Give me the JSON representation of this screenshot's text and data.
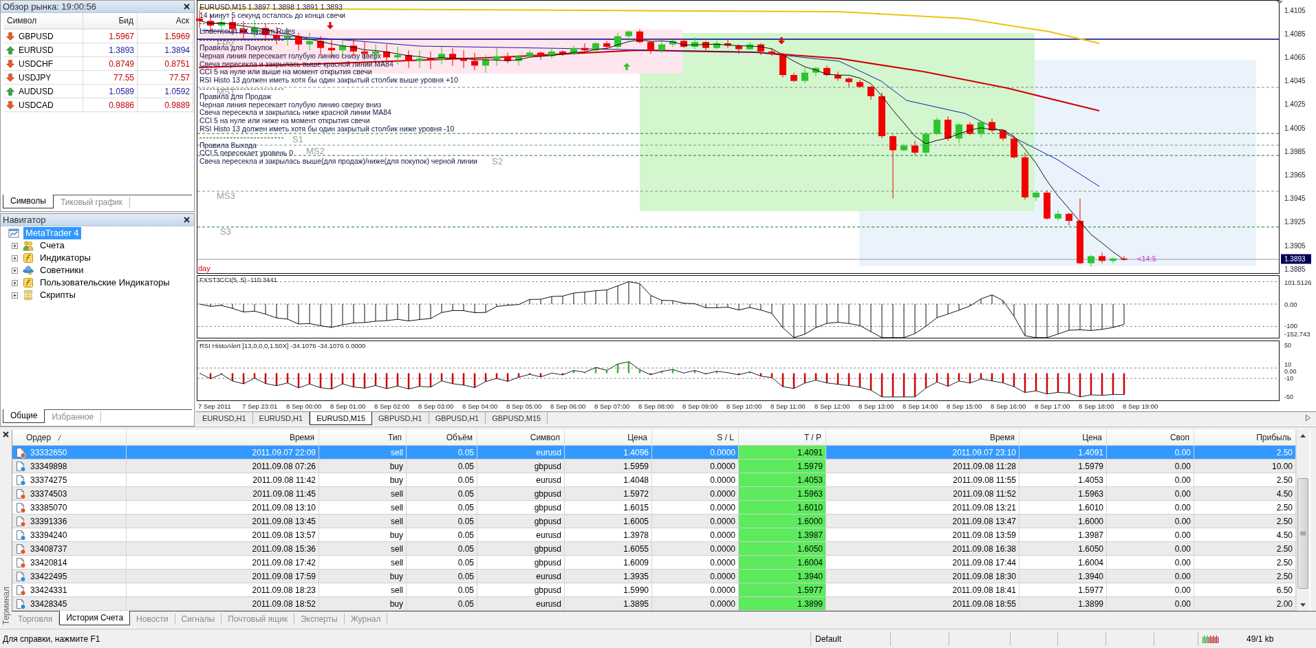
{
  "market_watch": {
    "title": "Обзор рынка: 19:00:56",
    "columns": [
      "Символ",
      "Бид",
      "Аск"
    ],
    "rows": [
      {
        "symbol": "GBPUSD",
        "bid": "1.5967",
        "ask": "1.5969",
        "rising": false
      },
      {
        "symbol": "EURUSD",
        "bid": "1.3893",
        "ask": "1.3894",
        "rising": true
      },
      {
        "symbol": "USDCHF",
        "bid": "0.8749",
        "ask": "0.8751",
        "rising": false
      },
      {
        "symbol": "USDJPY",
        "bid": "77.55",
        "ask": "77.57",
        "rising": false
      },
      {
        "symbol": "AUDUSD",
        "bid": "1.0589",
        "ask": "1.0592",
        "rising": true
      },
      {
        "symbol": "USDCAD",
        "bid": "0.9886",
        "ask": "0.9889",
        "rising": false
      }
    ],
    "tabs": [
      {
        "label": "Символы",
        "selected": true
      },
      {
        "label": "Тиковый график",
        "selected": false
      }
    ]
  },
  "navigator": {
    "title": "Навигатор",
    "tree": [
      {
        "label": "MetaTrader 4",
        "kind": "terminal",
        "selected": true,
        "children": [
          {
            "label": "Счета",
            "kind": "accounts",
            "selected": false,
            "expanded": false
          },
          {
            "label": "Индикаторы",
            "kind": "indicators",
            "selected": false,
            "expanded": false
          },
          {
            "label": "Советники",
            "kind": "experts",
            "selected": false,
            "expanded": false
          },
          {
            "label": "Пользовательские Индикаторы",
            "kind": "custom_indicators",
            "selected": false,
            "expanded": false
          },
          {
            "label": "Скрипты",
            "kind": "scripts",
            "selected": false,
            "expanded": false
          }
        ]
      }
    ],
    "tabs": [
      {
        "label": "Общие",
        "selected": true
      },
      {
        "label": "Избранное",
        "selected": false
      }
    ]
  },
  "chart": {
    "title": "EURUSD,M15 1.3897 1.3898 1.3891 1.3893",
    "notes": [
      {
        "kind": "text",
        "text": "14 минут 5 секунд осталось до конца свечи"
      },
      {
        "kind": "separator"
      },
      {
        "kind": "text",
        "text": "Lindencourt FX System Rules"
      },
      {
        "kind": "separator"
      },
      {
        "kind": "text",
        "text": "Правила для Покупок"
      },
      {
        "kind": "text",
        "text": "Черная линия пересекает голубую линию снизу вверх"
      },
      {
        "kind": "text",
        "text": "Свеча пересекла и закрылась выше красной линии MA84"
      },
      {
        "kind": "text",
        "text": "CCI 5 на нуле или выше на момент открытия свечи"
      },
      {
        "kind": "text",
        "text": "RSI Histo 13 должен иметь хотя бы один закрытый столбик выше уровня +10"
      },
      {
        "kind": "separator"
      },
      {
        "kind": "text",
        "text": "Правила для Продаж"
      },
      {
        "kind": "text",
        "text": "Черная линия пересекает голубую линию сверху вниз"
      },
      {
        "kind": "text",
        "text": "Свеча пересекла и закрылась ниже красной линии MA84"
      },
      {
        "kind": "text",
        "text": "CCI 5 на нуле или ниже на момент открытия свечи"
      },
      {
        "kind": "text",
        "text": "RSI Histo 13 должен иметь хотя бы один закрытый столбик ниже уровня -10"
      },
      {
        "kind": "separator"
      },
      {
        "kind": "text",
        "text": "Правила Выхода"
      },
      {
        "kind": "text",
        "text": "CCI 5 пересекает уровень 0"
      },
      {
        "kind": "text",
        "text": "Свеча пересекла и закрылась выше(для продаж)/ниже(для покупок) черной линии"
      }
    ],
    "levels": [
      {
        "label": "FPV",
        "kind": "pivot"
      },
      {
        "label": "MS1",
        "kind": "mid"
      },
      {
        "label": "S1",
        "kind": "support"
      },
      {
        "label": "MS2",
        "kind": "mid"
      },
      {
        "label": "S2",
        "kind": "support"
      },
      {
        "label": "MS3",
        "kind": "mid"
      },
      {
        "label": "S3",
        "kind": "support"
      }
    ],
    "period_label": "day",
    "countdown": "<14:5",
    "price_axis": [
      "1.4105",
      "1.4085",
      "1.4065",
      "1.4045",
      "1.4025",
      "1.4005",
      "1.3985",
      "1.3965",
      "1.3945",
      "1.3925",
      "1.3905",
      "1.3885"
    ],
    "current_price": "1.3893",
    "cci": {
      "title": "FXST3CCI(5, 5) -110.3441",
      "axis": [
        "101.5126",
        "0.00",
        "-100",
        "-152.743"
      ]
    },
    "rsi": {
      "title": "RSI HistoAlert [13,0,0,0,1.50X] -34.1076 -34.1076 0.0000",
      "axis": [
        "50",
        "10",
        "0.00",
        "-10",
        "-50"
      ]
    },
    "time_axis": [
      "7 Sep 2011",
      "7 Sep 23:01",
      "8 Sep 00:00",
      "8 Sep 01:00",
      "8 Sep 02:00",
      "8 Sep 03:00",
      "8 Sep 04:00",
      "8 Sep 05:00",
      "8 Sep 06:00",
      "8 Sep 07:00",
      "8 Sep 08:00",
      "8 Sep 09:00",
      "8 Sep 10:00",
      "8 Sep 11:00",
      "8 Sep 12:00",
      "8 Sep 13:00",
      "8 Sep 14:00",
      "8 Sep 15:00",
      "8 Sep 16:00",
      "8 Sep 17:00",
      "8 Sep 18:00",
      "8 Sep 19:00"
    ]
  },
  "chart_tabs": [
    {
      "label": "EURUSD,H1",
      "selected": false
    },
    {
      "label": "EURUSD,H1",
      "selected": false
    },
    {
      "label": "EURUSD,M15",
      "selected": true
    },
    {
      "label": "GBPUSD,H1",
      "selected": false
    },
    {
      "label": "GBPUSD,H1",
      "selected": false
    },
    {
      "label": "GBPUSD,M15",
      "selected": false
    }
  ],
  "terminal": {
    "title": "Терминал",
    "columns": [
      {
        "label": "Ордер",
        "sorted": true,
        "highlighted": false
      },
      {
        "label": "Время",
        "sorted": false,
        "highlighted": false
      },
      {
        "label": "Тип",
        "sorted": false,
        "highlighted": false
      },
      {
        "label": "Объём",
        "sorted": false,
        "highlighted": false
      },
      {
        "label": "Символ",
        "sorted": false,
        "highlighted": false
      },
      {
        "label": "Цена",
        "sorted": false,
        "highlighted": false
      },
      {
        "label": "S / L",
        "sorted": false,
        "highlighted": false
      },
      {
        "label": "T / P",
        "sorted": false,
        "highlighted": true
      },
      {
        "label": "Время",
        "sorted": false,
        "highlighted": false
      },
      {
        "label": "Цена",
        "sorted": false,
        "highlighted": false
      },
      {
        "label": "Своп",
        "sorted": false,
        "highlighted": false
      },
      {
        "label": "Прибыль",
        "sorted": false,
        "highlighted": false
      }
    ],
    "rows": [
      {
        "kind": "sell",
        "selected": true,
        "cells": [
          "33332650",
          "2011.09.07 22:09",
          "sell",
          "0.05",
          "eurusd",
          "1.4096",
          "0.0000",
          "1.4091",
          "2011.09.07 23:10",
          "1.4091",
          "0.00",
          "2.50"
        ]
      },
      {
        "kind": "buy",
        "selected": false,
        "cells": [
          "33349898",
          "2011.09.08 07:26",
          "buy",
          "0.05",
          "gbpusd",
          "1.5959",
          "0.0000",
          "1.5979",
          "2011.09.08 11:28",
          "1.5979",
          "0.00",
          "10.00"
        ]
      },
      {
        "kind": "buy",
        "selected": false,
        "cells": [
          "33374275",
          "2011.09.08 11:42",
          "buy",
          "0.05",
          "eurusd",
          "1.4048",
          "0.0000",
          "1.4053",
          "2011.09.08 11:55",
          "1.4053",
          "0.00",
          "2.50"
        ]
      },
      {
        "kind": "sell",
        "selected": false,
        "cells": [
          "33374503",
          "2011.09.08 11:45",
          "sell",
          "0.05",
          "gbpusd",
          "1.5972",
          "0.0000",
          "1.5963",
          "2011.09.08 11:52",
          "1.5963",
          "0.00",
          "4.50"
        ]
      },
      {
        "kind": "sell",
        "selected": false,
        "cells": [
          "33385070",
          "2011.09.08 13:10",
          "sell",
          "0.05",
          "gbpusd",
          "1.6015",
          "0.0000",
          "1.6010",
          "2011.09.08 13:21",
          "1.6010",
          "0.00",
          "2.50"
        ]
      },
      {
        "kind": "sell",
        "selected": false,
        "cells": [
          "33391336",
          "2011.09.08 13:45",
          "sell",
          "0.05",
          "gbpusd",
          "1.6005",
          "0.0000",
          "1.6000",
          "2011.09.08 13:47",
          "1.6000",
          "0.00",
          "2.50"
        ]
      },
      {
        "kind": "buy",
        "selected": false,
        "cells": [
          "33394240",
          "2011.09.08 13:57",
          "buy",
          "0.05",
          "eurusd",
          "1.3978",
          "0.0000",
          "1.3987",
          "2011.09.08 13:59",
          "1.3987",
          "0.00",
          "4.50"
        ]
      },
      {
        "kind": "sell",
        "selected": false,
        "cells": [
          "33408737",
          "2011.09.08 15:36",
          "sell",
          "0.05",
          "gbpusd",
          "1.6055",
          "0.0000",
          "1.6050",
          "2011.09.08 16:38",
          "1.6050",
          "0.00",
          "2.50"
        ]
      },
      {
        "kind": "sell",
        "selected": false,
        "cells": [
          "33420814",
          "2011.09.08 17:42",
          "sell",
          "0.05",
          "gbpusd",
          "1.6009",
          "0.0000",
          "1.6004",
          "2011.09.08 17:44",
          "1.6004",
          "0.00",
          "2.50"
        ]
      },
      {
        "kind": "buy",
        "selected": false,
        "cells": [
          "33422495",
          "2011.09.08 17:59",
          "buy",
          "0.05",
          "eurusd",
          "1.3935",
          "0.0000",
          "1.3940",
          "2011.09.08 18:30",
          "1.3940",
          "0.00",
          "2.50"
        ]
      },
      {
        "kind": "sell",
        "selected": false,
        "cells": [
          "33424331",
          "2011.09.08 18:23",
          "sell",
          "0.05",
          "gbpusd",
          "1.5990",
          "0.0000",
          "1.5977",
          "2011.09.08 18:41",
          "1.5977",
          "0.00",
          "6.50"
        ]
      },
      {
        "kind": "buy",
        "selected": false,
        "cells": [
          "33428345",
          "2011.09.08 18:52",
          "buy",
          "0.05",
          "eurusd",
          "1.3895",
          "0.0000",
          "1.3899",
          "2011.09.08 18:55",
          "1.3899",
          "0.00",
          "2.00"
        ]
      }
    ],
    "tabs": [
      {
        "label": "Торговля",
        "selected": false
      },
      {
        "label": "История Счета",
        "selected": true
      },
      {
        "label": "Новости",
        "selected": false
      },
      {
        "label": "Сигналы",
        "selected": false
      },
      {
        "label": "Почтовый ящик",
        "selected": false
      },
      {
        "label": "Эксперты",
        "selected": false
      },
      {
        "label": "Журнал",
        "selected": false
      }
    ]
  },
  "status_bar": {
    "help": "Для справки, нажмите F1",
    "profile": "Default",
    "traffic": "49/1 kb"
  }
}
